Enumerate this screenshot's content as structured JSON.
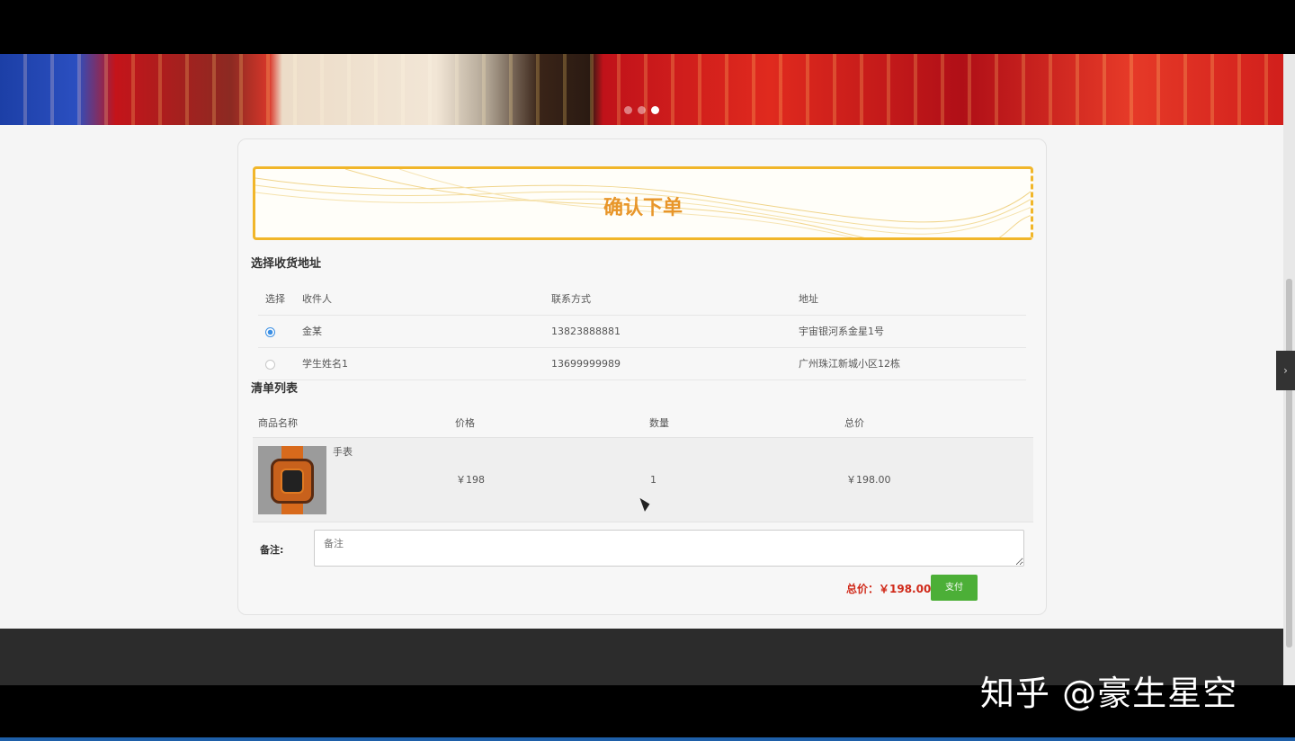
{
  "hero_title": "确认下单",
  "address_section": {
    "title": "选择收货地址",
    "headers": [
      "选择",
      "收件人",
      "联系方式",
      "地址"
    ],
    "rows": [
      {
        "selected": true,
        "name": "金某",
        "phone": "13823888881",
        "address": "宇宙银河系金星1号"
      },
      {
        "selected": false,
        "name": "学生姓名1",
        "phone": "13699999989",
        "address": "广州珠江新城小区12栋"
      }
    ]
  },
  "list_section": {
    "title": "清单列表",
    "headers": [
      "商品名称",
      "价格",
      "数量",
      "总价"
    ],
    "items": [
      {
        "name": "手表",
        "price": "￥198",
        "qty": "1",
        "subtotal": "￥198.00"
      }
    ]
  },
  "remark": {
    "label": "备注:",
    "placeholder": "备注"
  },
  "total": {
    "label": "总价：￥198.00"
  },
  "pay_button": "支付",
  "side_tab_icon": "chevron-right-icon",
  "watermark": "知乎 @豪生星空",
  "colors": {
    "accent": "#e8962a",
    "pay": "#4caf37",
    "total": "#d02a1a",
    "radio": "#3b8fe4"
  }
}
